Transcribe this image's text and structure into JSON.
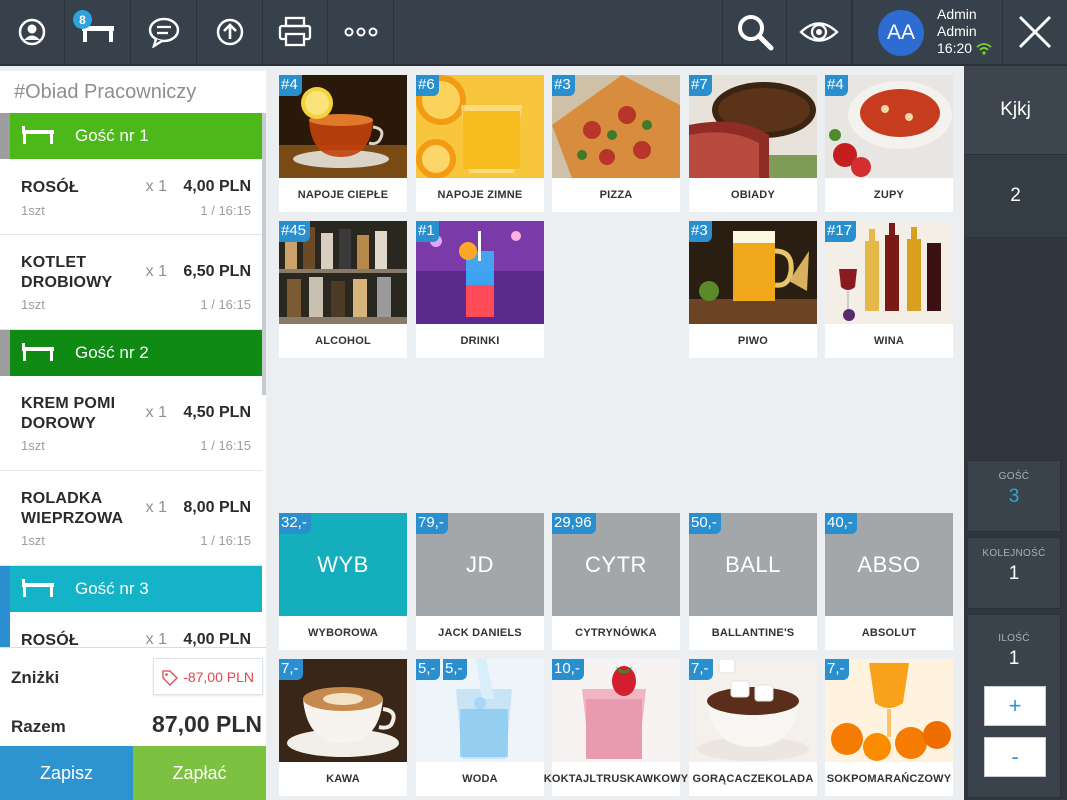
{
  "topbar": {
    "tables_badge": "8",
    "user_initials": "AA",
    "user_first": "Admin",
    "user_last": "Admin",
    "time": "16:20"
  },
  "order": {
    "title": "#Obiad Pracowniczy",
    "guest1": "Gość nr 1",
    "guest2": "Gość nr 2",
    "guest3": "Gość nr 3",
    "items": [
      {
        "name1": "ROSÓŁ",
        "name2": "",
        "qty": "x 1",
        "price": "4,00 PLN",
        "unit": "1szt",
        "seq": "1 / 16:15"
      },
      {
        "name1": "KOTLET",
        "name2": "DROBIOWY",
        "qty": "x 1",
        "price": "6,50 PLN",
        "unit": "1szt",
        "seq": "1 / 16:15"
      },
      {
        "name1": "KREM POMI",
        "name2": "DOROWY",
        "qty": "x 1",
        "price": "4,50 PLN",
        "unit": "1szt",
        "seq": "1 / 16:15"
      },
      {
        "name1": "ROLADKA",
        "name2": "WIEPRZOWA",
        "qty": "x 1",
        "price": "8,00 PLN",
        "unit": "1szt",
        "seq": "1 / 16:15"
      },
      {
        "name1": "ROSÓŁ",
        "name2": "",
        "qty": "x 1",
        "price": "4,00 PLN",
        "unit": "",
        "seq": ""
      }
    ],
    "discount_label": "Zniżki",
    "discount_value": "-87,00 PLN",
    "total_label": "Razem",
    "total_value": "87,00 PLN",
    "save_label": "Zapisz",
    "pay_label": "Zapłać"
  },
  "categories": [
    {
      "tag": "#4",
      "label": "NAPOJE CIEPŁE"
    },
    {
      "tag": "#6",
      "label": "NAPOJE ZIMNE"
    },
    {
      "tag": "#3",
      "label": "PIZZA"
    },
    {
      "tag": "#7",
      "label": "OBIADY"
    },
    {
      "tag": "#4",
      "label": "ZUPY"
    },
    {
      "tag": "#45",
      "label": "ALCOHOL"
    },
    {
      "tag": "#1",
      "label": "DRINKI"
    },
    {
      "tag": "#3",
      "label": "PIWO"
    },
    {
      "tag": "#17",
      "label": "WINA"
    }
  ],
  "products": [
    {
      "price": "32,-",
      "abbr": "WYB",
      "label": "WYBOROWA"
    },
    {
      "price": "79,-",
      "abbr": "JD",
      "label": "JACK DANIELS"
    },
    {
      "price": "29,96",
      "abbr": "CYTR",
      "label": "CYTRYNÓWKA"
    },
    {
      "price": "50,-",
      "abbr": "BALL",
      "label": "BALLANTINE'S"
    },
    {
      "price": "40,-",
      "abbr": "ABSO",
      "label": "ABSOLUT"
    },
    {
      "price": "7,-",
      "label": "KAWA"
    },
    {
      "price": "5,-",
      "price2": "5,-",
      "label": "WODA"
    },
    {
      "price": "10,-",
      "label1": "KOKTAJL",
      "label2": "TRUSKAWKOWY"
    },
    {
      "price": "7,-",
      "label1": "GORĄCA",
      "label2": "CZEKOLADA"
    },
    {
      "price": "7,-",
      "label1": "SOK",
      "label2": "POMARAŃCZOWY"
    }
  ],
  "right": {
    "top_label": "Kjkj",
    "second_value": "2",
    "guest_label": "GOŚĆ",
    "guest_value": "3",
    "sequence_label": "KOLEJNOŚĆ",
    "sequence_value": "1",
    "qty_label": "ILOŚĆ",
    "qty_value": "1",
    "plus": "+",
    "minus": "-"
  },
  "colors": {
    "topbar": "#37414b",
    "guest1": "#4cb81a",
    "guest2": "#0f8a13",
    "guest3": "#14b3c8",
    "save": "#2e93d1",
    "pay": "#7cc13f",
    "tag": "#2a8fcf",
    "tile_teal": "#15aebc",
    "tile_grey": "#a4a7aa"
  }
}
